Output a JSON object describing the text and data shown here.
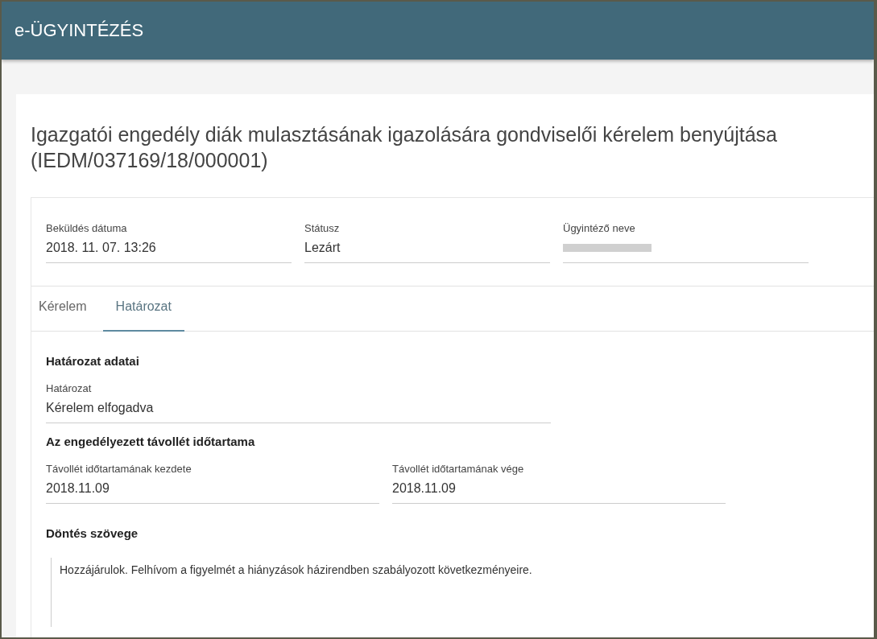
{
  "header": {
    "title": "e-ÜGYINTÉZÉS"
  },
  "page_title": "Igazgatói engedély diák mulasztásának igazolására gondviselői kérelem benyújtása (IEDM/037169/18/000001)",
  "summary_fields": [
    {
      "label": "Beküldés dátuma",
      "value": "2018. 11. 07. 13:26",
      "redacted": false
    },
    {
      "label": "Státusz",
      "value": "Lezárt",
      "redacted": false
    },
    {
      "label": "Ügyintéző neve",
      "redacted": true
    }
  ],
  "tabs": [
    {
      "label": "Kérelem",
      "selected": false
    },
    {
      "label": "Határozat",
      "selected": true
    }
  ],
  "decision": {
    "heading": "Határozat adatai",
    "field": {
      "label": "Határozat",
      "value": "Kérelem elfogadva"
    }
  },
  "absence": {
    "heading": "Az engedélyezett távollét időtartama",
    "fields": [
      {
        "label": "Távollét időtartamának kezdete",
        "value": "2018.11.09"
      },
      {
        "label": "Távollét időtartamának vége",
        "value": "2018.11.09"
      }
    ]
  },
  "decision_text": {
    "heading": "Döntés szövege",
    "text": "Hozzájárulok. Felhívom a figyelmét a hiányzások házirendben szabályozott következményeire."
  }
}
